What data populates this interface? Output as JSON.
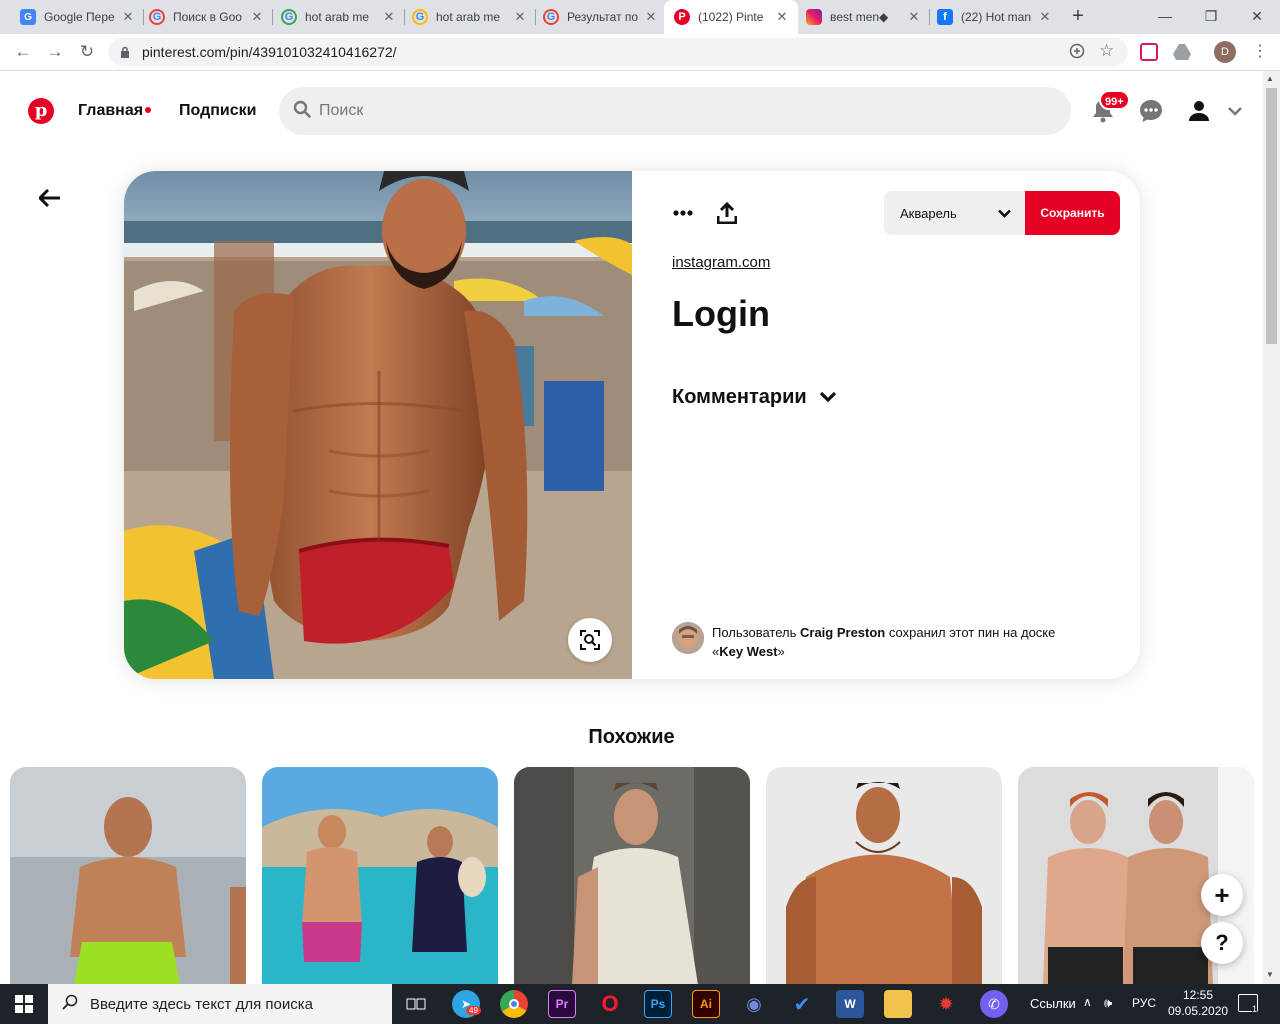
{
  "browser": {
    "tabs": [
      {
        "title": "Google Пере",
        "favicon": "google-translate-icon"
      },
      {
        "title": "Поиск в Goo",
        "favicon": "google-icon"
      },
      {
        "title": "hot arab me",
        "favicon": "google-icon"
      },
      {
        "title": "hot arab me",
        "favicon": "google-icon"
      },
      {
        "title": "Результат по",
        "favicon": "google-icon"
      },
      {
        "title": "(1022) Pinte",
        "favicon": "pinterest-icon"
      },
      {
        "title": "вest men◆",
        "favicon": "instagram-icon"
      },
      {
        "title": "(22) Hot man",
        "favicon": "facebook-icon"
      }
    ],
    "active_tab": 5,
    "url": "pinterest.com/pin/439101032410416272/",
    "profile_initial": "D"
  },
  "pinterest": {
    "nav": {
      "home": "Главная",
      "following": "Подписки"
    },
    "search_placeholder": "Поиск",
    "notifications_badge": "99+",
    "pin": {
      "board_selected": "Акварель",
      "save_label": "Сохранить",
      "source_link": "instagram.com",
      "title": "Login",
      "comments_label": "Комментарии",
      "attribution": {
        "prefix": "Пользователь",
        "user": "Craig Preston",
        "middle": "сохранил этот пин на доске",
        "open_quote": "«",
        "board": "Key West",
        "close_quote": "»"
      }
    },
    "similar_heading": "Похожие",
    "similar_pins": [
      "similar-pin-1",
      "similar-pin-2",
      "similar-pin-3",
      "similar-pin-4",
      "similar-pin-5"
    ],
    "fab_plus": "+",
    "fab_help": "?"
  },
  "taskbar": {
    "search_placeholder": "Введите здесь текст для поиска",
    "telegram_badge": "49",
    "apps": [
      "task-view-icon",
      "telegram-icon",
      "chrome-icon",
      "premiere-icon",
      "opera-icon",
      "photoshop-icon",
      "illustrator-icon",
      "discord-icon",
      "todo-icon",
      "word-icon",
      "explorer-icon",
      "game-icon",
      "viber-icon"
    ],
    "tray_links": "Ссылки",
    "lang": "РУС",
    "time": "12:55",
    "date": "09.05.2020",
    "notifications": "1"
  },
  "colors": {
    "pinterest_red": "#e60023",
    "taskbar": "#1e2229",
    "tab_strip": "#dee1e6"
  }
}
